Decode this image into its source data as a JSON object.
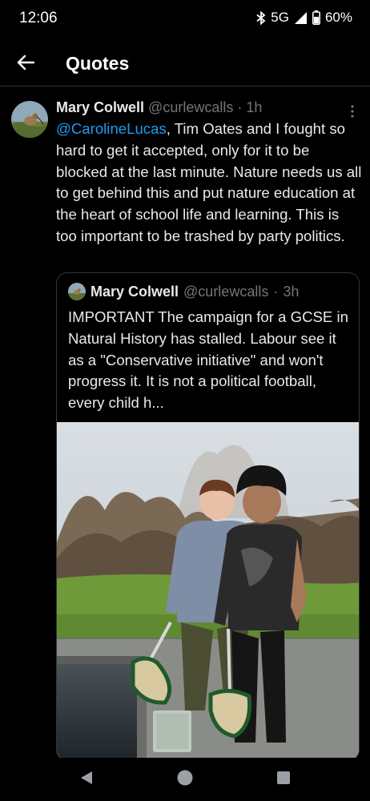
{
  "status_bar": {
    "time": "12:06",
    "network": "5G",
    "battery": "60%",
    "icons": [
      "bluetooth-icon",
      "signal-icon",
      "battery-icon"
    ]
  },
  "header": {
    "title": "Quotes",
    "back_icon": "arrow-left-icon"
  },
  "tweet": {
    "author_name": "Mary Colwell",
    "author_handle": "@curlewcalls",
    "separator": "·",
    "time": "1h",
    "mention": "@CarolineLucas",
    "body": ", Tim Oates and I fought so hard to get it accepted, only for it to be blocked at the last minute. Nature needs us all to get behind this and put nature education at the heart of school life and learning. This is too important to be trashed by party politics.",
    "more_icon": "more-vertical-icon"
  },
  "quoted_tweet": {
    "author_name": "Mary Colwell",
    "author_handle": "@curlewcalls",
    "separator": "·",
    "time": "3h",
    "body": "IMPORTANT The campaign for a GCSE in Natural History has stalled. Labour see it as a \"Conservative initiative\" and won't progress it. It is not a political football, every child h...",
    "image": "photo-two-boys-pond-dipping-nets"
  },
  "nav_bar": {
    "icons": [
      "back-triangle-icon",
      "home-circle-icon",
      "recents-square-icon"
    ]
  },
  "colors": {
    "background": "#000000",
    "text": "#e7e9ea",
    "secondary": "#71767b",
    "link": "#1d9bf0",
    "border": "#2f3336"
  }
}
